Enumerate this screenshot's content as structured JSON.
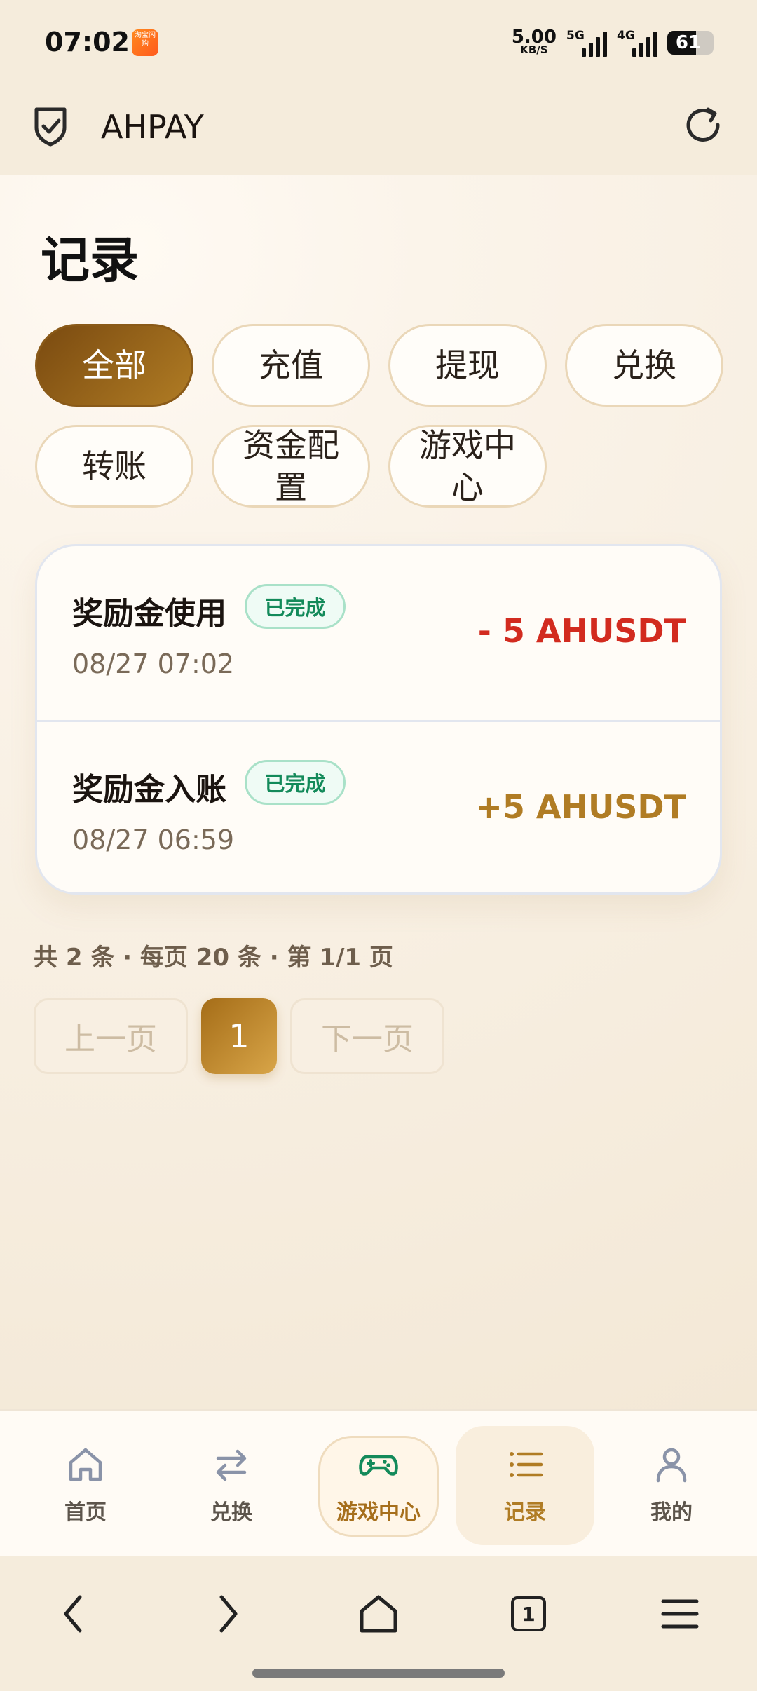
{
  "status_bar": {
    "time": "07:02",
    "app_icon_text": "淘宝闪购",
    "net_speed": "5.00",
    "net_speed_unit": "KB/S",
    "signal1_label": "5G",
    "signal2_label": "4G",
    "battery": "61"
  },
  "app_bar": {
    "title": "AHPAY"
  },
  "page": {
    "title": "记录"
  },
  "filters": [
    {
      "label": "全部",
      "active": true
    },
    {
      "label": "充值"
    },
    {
      "label": "提现"
    },
    {
      "label": "兑换"
    },
    {
      "label": "转账"
    },
    {
      "label": "资金配置"
    },
    {
      "label": "游戏中心"
    }
  ],
  "records": [
    {
      "title": "奖励金使用",
      "status": "已完成",
      "time": "08/27 07:02",
      "amount": "- 5 AHUSDT"
    },
    {
      "title": "奖励金入账",
      "status": "已完成",
      "time": "08/27 06:59",
      "amount": "+5 AHUSDT"
    }
  ],
  "pagination": {
    "summary": "共 2 条 · 每页 20 条 · 第 1/1 页",
    "prev": "上一页",
    "current": "1",
    "next": "下一页"
  },
  "bottom_nav": [
    {
      "label": "首页",
      "icon": "home-icon"
    },
    {
      "label": "兑换",
      "icon": "swap-icon"
    },
    {
      "label": "游戏中心",
      "icon": "gamepad-icon"
    },
    {
      "label": "记录",
      "icon": "list-icon",
      "active": true
    },
    {
      "label": "我的",
      "icon": "user-icon"
    }
  ],
  "browser_bar": {
    "tab_count": "1"
  },
  "colors": {
    "accent_gold": "#b07c24",
    "negative_red": "#d22b1f",
    "success_green": "#138a5a",
    "game_green": "#138a5a"
  }
}
